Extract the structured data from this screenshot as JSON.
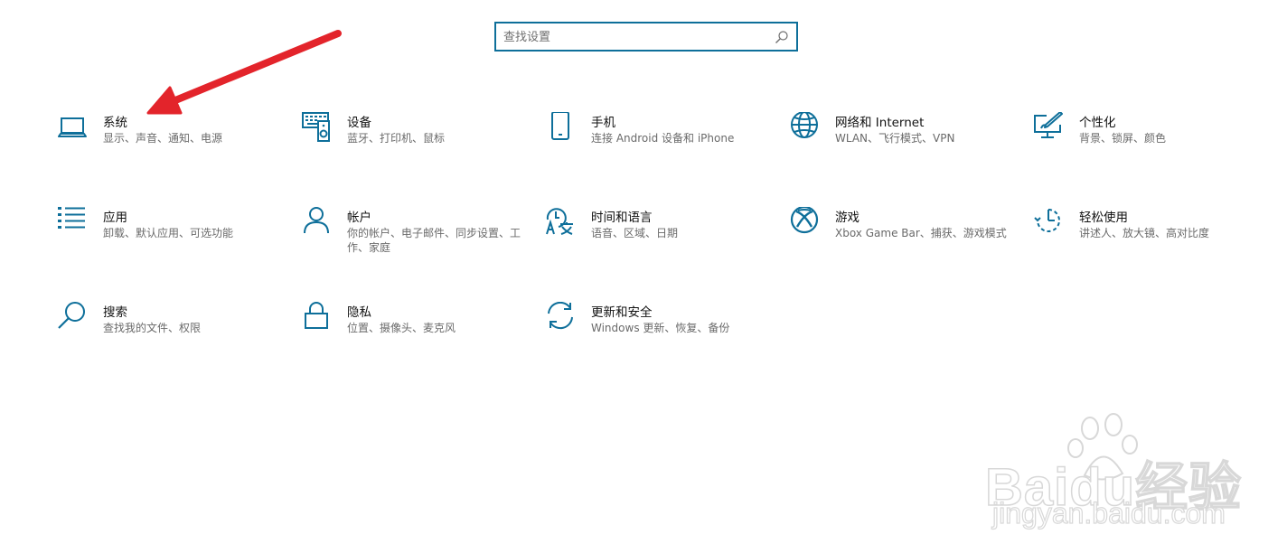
{
  "search": {
    "placeholder": "查找设置",
    "icon": "search-icon"
  },
  "accent_color": "#0e6f9a",
  "annotation_color": "#e3242b",
  "tiles": [
    {
      "title": "系统",
      "desc": "显示、声音、通知、电源",
      "icon": "laptop-icon"
    },
    {
      "title": "设备",
      "desc": "蓝牙、打印机、鼠标",
      "icon": "keyboard-speaker-icon"
    },
    {
      "title": "手机",
      "desc": "连接 Android 设备和 iPhone",
      "icon": "phone-icon"
    },
    {
      "title": "网络和 Internet",
      "desc": "WLAN、飞行模式、VPN",
      "icon": "globe-icon"
    },
    {
      "title": "个性化",
      "desc": "背景、锁屏、颜色",
      "icon": "paint-brush-monitor-icon"
    },
    {
      "title": "应用",
      "desc": "卸载、默认应用、可选功能",
      "icon": "app-list-icon"
    },
    {
      "title": "帐户",
      "desc": "你的帐户、电子邮件、同步设置、工作、家庭",
      "icon": "person-icon"
    },
    {
      "title": "时间和语言",
      "desc": "语音、区域、日期",
      "icon": "time-language-icon"
    },
    {
      "title": "游戏",
      "desc": "Xbox Game Bar、捕获、游戏模式",
      "icon": "xbox-icon"
    },
    {
      "title": "轻松使用",
      "desc": "讲述人、放大镜、高对比度",
      "icon": "ease-of-access-icon"
    },
    {
      "title": "搜索",
      "desc": "查找我的文件、权限",
      "icon": "magnifier-icon"
    },
    {
      "title": "隐私",
      "desc": "位置、摄像头、麦克风",
      "icon": "lock-icon"
    },
    {
      "title": "更新和安全",
      "desc": "Windows 更新、恢复、备份",
      "icon": "sync-icon"
    }
  ],
  "watermark": {
    "main": "Baidu经验",
    "sub": "jingyan.baidu.com"
  }
}
